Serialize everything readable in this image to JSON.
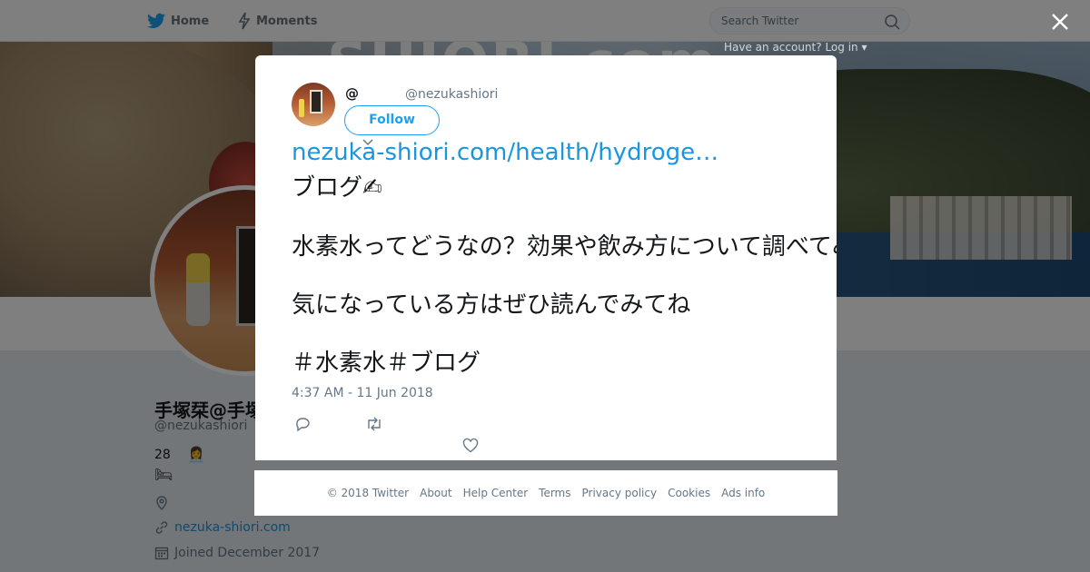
{
  "topbar": {
    "home_label": "Home",
    "moments_label": "Moments",
    "search_placeholder": "Search Twitter"
  },
  "banner": {
    "text": "SHIORI.com",
    "hint": "Have an account? Log in ▾"
  },
  "profile": {
    "name": "手塚栞@手塚しおり",
    "handle": "@nezukashiori",
    "bio_count": "28",
    "url": "nezuka-shiori.com",
    "joined": "Joined December 2017"
  },
  "tweet": {
    "name": "@",
    "handle": "@nezukashiori",
    "follow_label": "Follow",
    "link": "nezuka-shiori.com/health/hydroge…",
    "lines": [
      "ブログ✍",
      "水素水ってどうなの？効果や飲み方について調べてみました。",
      "気になっている方はぜひ読んでみてね",
      "＃水素水＃ブログ"
    ],
    "timestamp": "4:37 AM - 11 Jun 2018"
  },
  "footer": {
    "items": [
      "© 2018 Twitter",
      "About",
      "Help Center",
      "Terms",
      "Privacy policy",
      "Cookies",
      "Ads info"
    ]
  },
  "colors": {
    "accent": "#1da1f2",
    "link": "#1b95e0",
    "muted": "#657786"
  }
}
